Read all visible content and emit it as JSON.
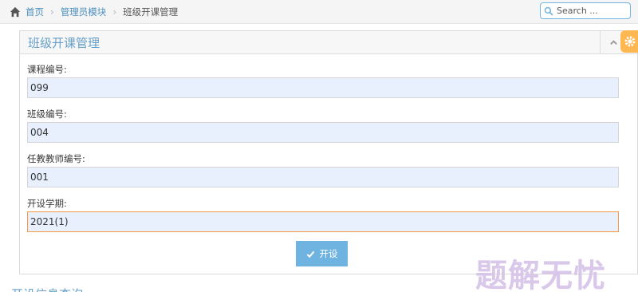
{
  "breadcrumb": {
    "home_label": "首页",
    "module_label": "管理员模块",
    "current_label": "班级开课管理"
  },
  "search": {
    "placeholder": "Search ..."
  },
  "widget": {
    "title": "班级开课管理"
  },
  "form": {
    "fields": [
      {
        "label": "课程编号:",
        "value": "099"
      },
      {
        "label": "班级编号:",
        "value": "004"
      },
      {
        "label": "任教教师编号:",
        "value": "001"
      },
      {
        "label": "开设学期:",
        "value": "2021(1)"
      }
    ],
    "submit_label": "开设"
  },
  "bottom_link": "开设信息查询",
  "watermark": "题解无忧",
  "colors": {
    "accent": "#6fb3e0",
    "title": "#669fc7",
    "settings_tab": "#ffb752",
    "input_bg": "#e8f0fe"
  }
}
